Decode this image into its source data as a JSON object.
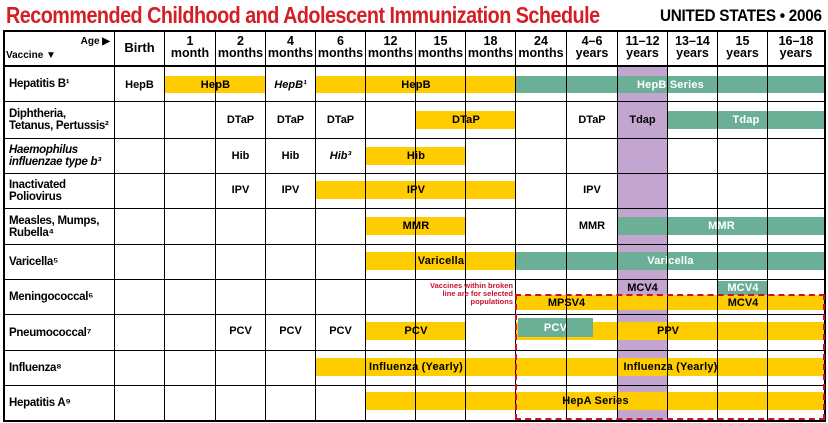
{
  "title": "Recommended Childhood and Adolescent Immunization Schedule",
  "title_right": "UNITED STATES • 2006",
  "corner": {
    "vaccine_label": "Vaccine ▼",
    "age_label": "Age ▶"
  },
  "ages": [
    {
      "l1": "Birth",
      "l2": ""
    },
    {
      "l1": "1",
      "l2": "month"
    },
    {
      "l1": "2",
      "l2": "months"
    },
    {
      "l1": "4",
      "l2": "months"
    },
    {
      "l1": "6",
      "l2": "months"
    },
    {
      "l1": "12",
      "l2": "months"
    },
    {
      "l1": "15",
      "l2": "months"
    },
    {
      "l1": "18",
      "l2": "months"
    },
    {
      "l1": "24",
      "l2": "months"
    },
    {
      "l1": "4–6",
      "l2": "years"
    },
    {
      "l1": "11–12",
      "l2": "years"
    },
    {
      "l1": "13–14",
      "l2": "years"
    },
    {
      "l1": "15",
      "l2": "years"
    },
    {
      "l1": "16–18",
      "l2": "years"
    }
  ],
  "rows": [
    {
      "l1": "Hepatitis B¹",
      "l2": ""
    },
    {
      "l1": "Diphtheria,",
      "l2": "Tetanus, Pertussis²"
    },
    {
      "l1": "Haemophilus",
      "l2": "influenzae type b³"
    },
    {
      "l1": "Inactivated",
      "l2": "Poliovirus"
    },
    {
      "l1": "Measles, Mumps,",
      "l2": "Rubella⁴"
    },
    {
      "l1": "Varicella⁵",
      "l2": ""
    },
    {
      "l1": "Meningococcal⁶",
      "l2": ""
    },
    {
      "l1": "Pneumococcal⁷",
      "l2": ""
    },
    {
      "l1": "Influenza⁸",
      "l2": ""
    },
    {
      "l1": "Hepatitis A⁹",
      "l2": ""
    }
  ],
  "cells": {
    "hepb_birth": "HepB",
    "hepb_1": "HepB",
    "hepb_4": "HepB¹",
    "hepb_6": "HepB",
    "hepb_series": "HepB Series",
    "dtap_2": "DTaP",
    "dtap_4": "DTaP",
    "dtap_6": "DTaP",
    "dtap_15": "DTaP",
    "dtap_46": "DTaP",
    "tdap_11": "Tdap",
    "tdap_13": "Tdap",
    "hib_2": "Hib",
    "hib_4": "Hib",
    "hib_6": "Hib³",
    "hib_12": "Hib",
    "ipv_2": "IPV",
    "ipv_4": "IPV",
    "ipv_6": "IPV",
    "ipv_46": "IPV",
    "mmr_12": "MMR",
    "mmr_46": "MMR",
    "mmr_11": "MMR",
    "var_12": "Varicella",
    "var_24": "Varicella",
    "mcv4_11": "MCV4",
    "mcv4_15": "MCV4",
    "mcv4_13": "MCV4",
    "mpsv4": "MPSV4",
    "pcv_2": "PCV",
    "pcv_4": "PCV",
    "pcv_6": "PCV",
    "pcv_12": "PCV",
    "pcv_24": "PCV",
    "ppv": "PPV",
    "flu_6": "Influenza (Yearly)",
    "flu_24": "Influenza (Yearly)",
    "hepa": "HepA Series"
  },
  "note": "Vaccines within broken line are for selected populations",
  "colors": {
    "title": "#d31f26",
    "yellow": "#ffcc00",
    "green": "#6aaf96",
    "purple": "#c3a6cf",
    "dashed": "#c8102e"
  }
}
